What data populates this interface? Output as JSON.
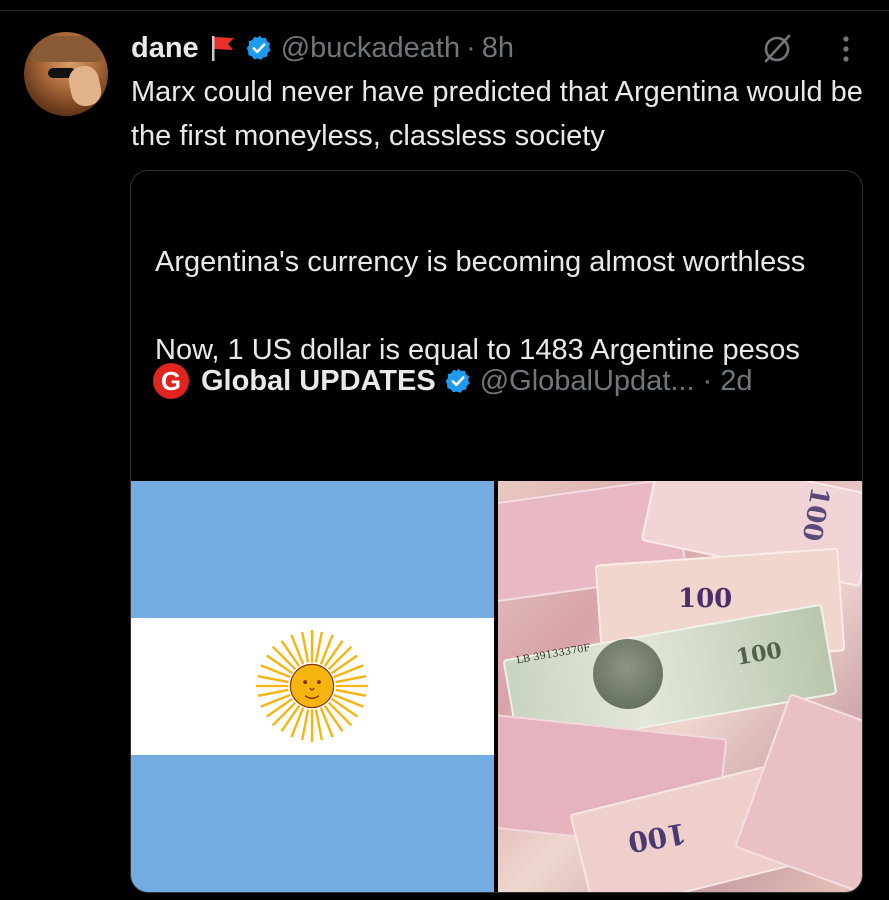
{
  "post": {
    "author_name": "dane",
    "handle": "@buckadeath",
    "separator": "·",
    "time": "8h",
    "text": "Marx could never have predicted that Argentina would be the first moneyless, classless society"
  },
  "quoted_post": {
    "logo_letter": "G",
    "author_name": "Global UPDATES",
    "handle": "@GlobalUpdat...",
    "separator": "·",
    "time": "2d",
    "text_line1": "Argentina's currency is becoming almost worthless",
    "text_line2": "Now, 1 US dollar is equal to 1483 Argentine pesos"
  },
  "money_labels": {
    "peso_value": "100",
    "dollar_value": "100",
    "serial": "LB 39133370F"
  },
  "colors": {
    "background": "#000000",
    "text_primary": "#e7e9ea",
    "text_secondary": "#71767b",
    "verified": "#1d9bf0",
    "flag_blue": "#74ace2",
    "logo_red": "#e0241f"
  },
  "icons": [
    "red-flag-icon",
    "verified-badge-icon",
    "grok-icon",
    "more-options-icon",
    "sun-of-may-icon"
  ]
}
